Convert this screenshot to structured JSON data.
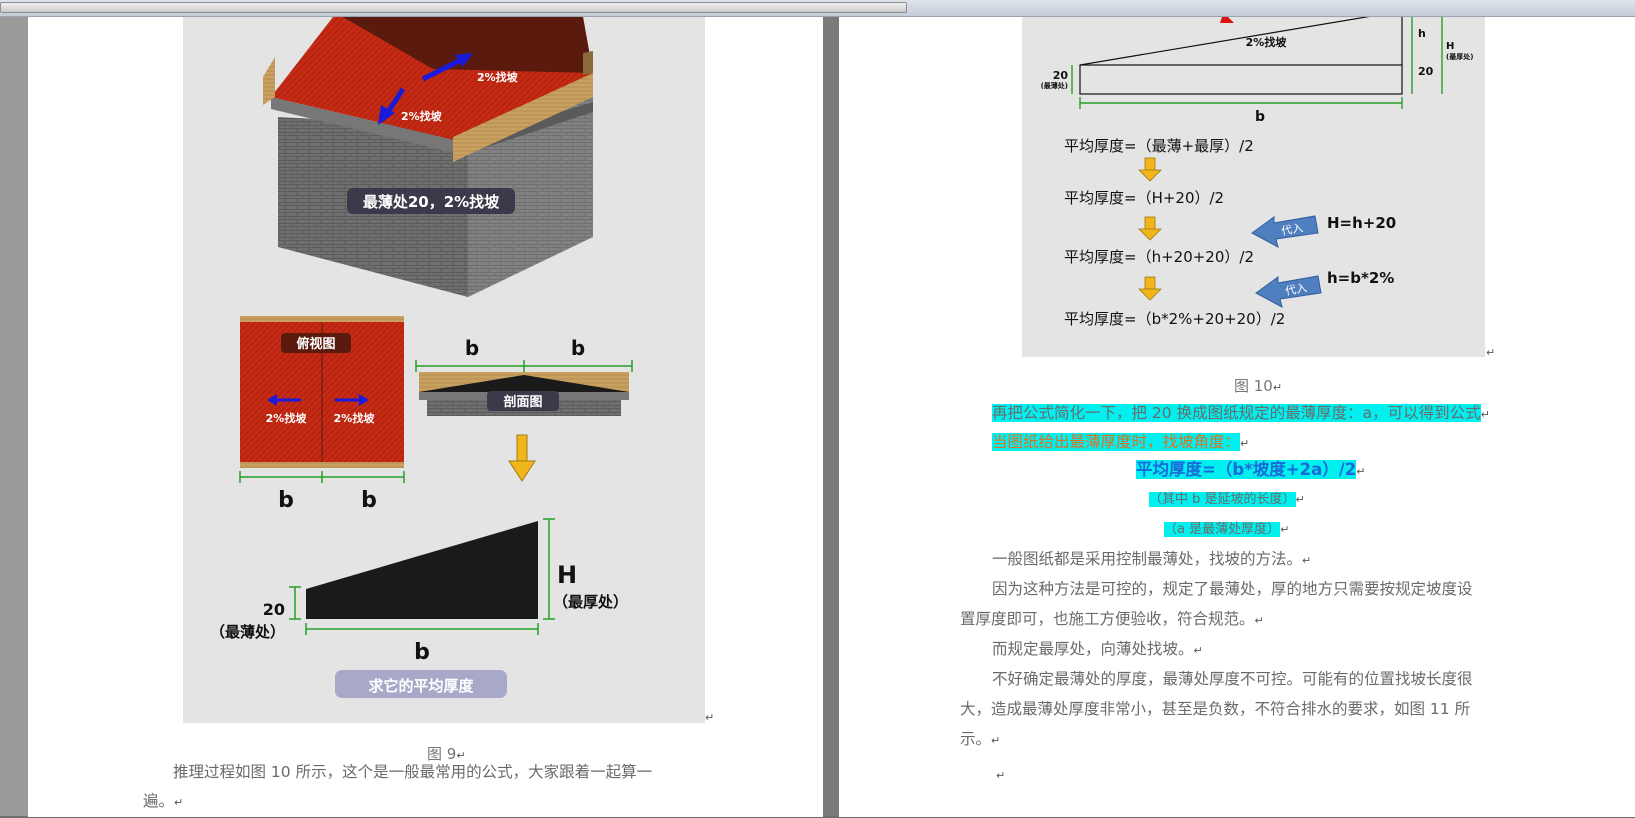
{
  "window": {
    "scrollbar": "horizontal-scrollbar"
  },
  "colors": {
    "highlight": "#00f0f0",
    "roof_red": "#c42a14",
    "arrow_blue": "#1a1adc",
    "arrow_yellow": "#f2b51c",
    "badge_blue": "#4f7fbe",
    "orange_text": "#e07020",
    "blue_text": "#1a6ad8"
  },
  "fig9": {
    "slope_label": "2%找坡",
    "house_label": "最薄处20，2%找坡",
    "top_view_label": "俯视图",
    "section_label": "剖面图",
    "b": "b",
    "H": "H",
    "thickest": "（最厚处）",
    "num20": "20",
    "thinnest": "（最薄处）",
    "ask_label": "求它的平均厚度",
    "caption": "图 9"
  },
  "left_text": {
    "line1": "推理过程如图 10 所示，这个是一般最常用的公式，大家跟着一起算一",
    "line2": "遍。"
  },
  "fig10": {
    "slope_label": "2%找坡",
    "h": "h",
    "H": "H",
    "thickest_small": "(最厚处)",
    "num20": "20",
    "thinnest_small": "(最薄处)",
    "b": "b",
    "formula1": "平均厚度=（最薄+最厚）/2",
    "formula2": "平均厚度=（H+20）/2",
    "formula3": "平均厚度=（h+20+20）/2",
    "formula4": "平均厚度=（b*2%+20+20）/2",
    "substitute": "代入",
    "eq1": "H=h+20",
    "eq2": "h=b*2%",
    "caption": "图 10"
  },
  "right_text": {
    "p1": "再把公式简化一下，把 20 换成图纸规定的最薄厚度：a，可以得到公式",
    "p2": "当图纸给出最薄厚度时，找坡角度：",
    "formula": "平均厚度=（b*坡度+2a）/2",
    "note1": "（其中 b 是延坡的长度）",
    "note2": "（a 是最薄处厚度）",
    "p3": "一般图纸都是采用控制最薄处，找坡的方法。",
    "p4a": "因为这种方法是可控的，规定了最薄处，厚的地方只需要按规定坡度设",
    "p4b": "置厚度即可，也施工方便验收，符合规范。",
    "p5": "而规定最厚处，向薄处找坡。",
    "p6a": "不好确定最薄处的厚度，最薄处厚度不可控。可能有的位置找坡长度很",
    "p6b": "大，造成最薄处厚度非常小，甚至是负数，不符合排水的要求，如图 11 所",
    "p6c": "示。"
  },
  "marks": {
    "return": "↵"
  }
}
